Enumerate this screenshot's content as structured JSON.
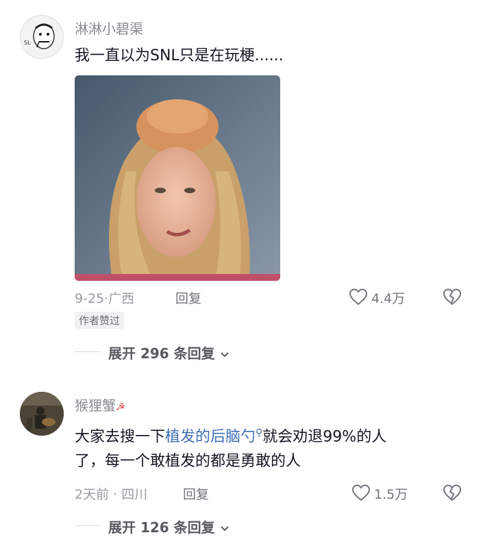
{
  "comments": [
    {
      "username": "淋淋小碧渠",
      "text": "我一直以为SNL只是在玩梗......",
      "date": "9-25",
      "location": "广西",
      "reply_label": "回复",
      "like_count": "4.4万",
      "badge": "作者赞过",
      "expand_label": "展开 296 条回复"
    },
    {
      "username": "猴狸蟹",
      "text_before": "大家去搜一下",
      "text_link": "植发的后脑勺",
      "text_after": "就会劝退99%的人",
      "text_line2": "了，每一个敢植发的都是勇敢的人",
      "date": "2天前",
      "location": "四川",
      "reply_label": "回复",
      "like_count": "1.5万",
      "expand_label": "展开 126 条回复"
    }
  ],
  "colors": {
    "link": "#3d6fb3",
    "muted": "#9a9ba1",
    "text": "#161823"
  }
}
